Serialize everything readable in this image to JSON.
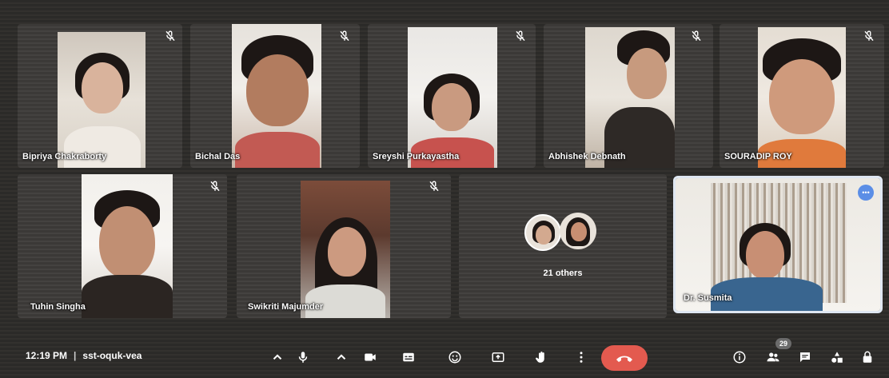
{
  "meeting": {
    "time": "12:19 PM",
    "separator": "|",
    "code": "sst-oquk-vea"
  },
  "participants": [
    {
      "name": "Bipriya Chakraborty",
      "muted": true
    },
    {
      "name": "Bichal Das",
      "muted": true
    },
    {
      "name": "Sreyshi Purkayastha",
      "muted": true
    },
    {
      "name": "Abhishek Debnath",
      "muted": true
    },
    {
      "name": "SOURADIP ROY",
      "muted": true
    },
    {
      "name": "Tuhin Singha",
      "muted": true
    },
    {
      "name": "Swikriti Majumder",
      "muted": true
    },
    {
      "name": "Dr. Susmita",
      "muted": false,
      "speaking": true
    }
  ],
  "others": {
    "label": "21 others"
  },
  "toolbar": {
    "participant_count": "29",
    "icons": [
      "chevron-up-icon",
      "microphone-icon",
      "camera-icon",
      "captions-icon",
      "emoji-icon",
      "present-icon",
      "raise-hand-icon",
      "more-options-icon",
      "end-call-icon",
      "info-icon",
      "people-icon",
      "chat-icon",
      "activities-icon",
      "lock-icon"
    ]
  },
  "colors": {
    "end_call": "#e35a4f",
    "speaking_indicator": "#5b8ee6",
    "presenter_border": "#dfe7f2"
  }
}
